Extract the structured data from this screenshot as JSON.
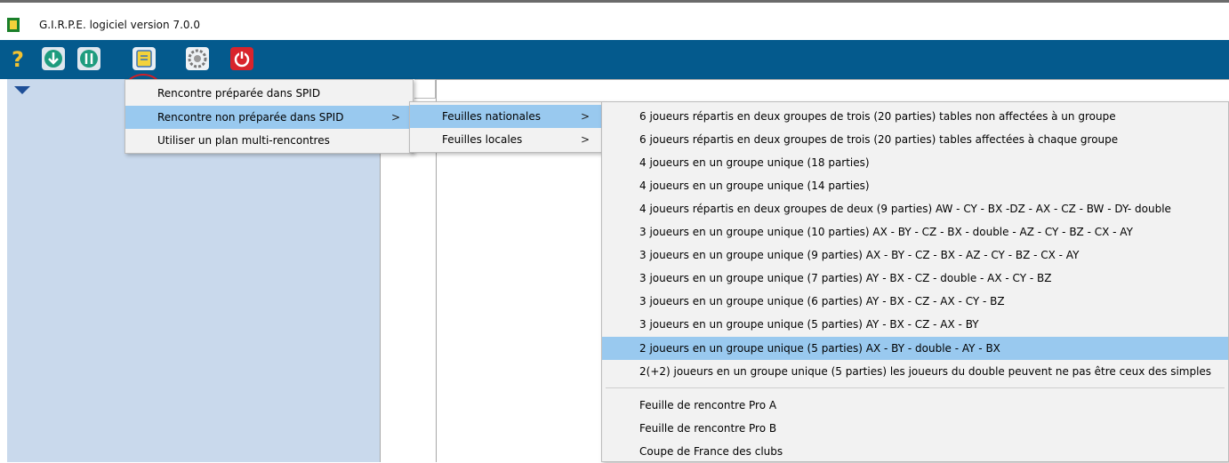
{
  "app": {
    "title": "G.I.R.P.E.  logiciel version  7.0.0"
  },
  "toolbar": {
    "buttons": [
      {
        "icon": "help-icon"
      },
      {
        "icon": "download-icon"
      },
      {
        "icon": "sync-icon"
      },
      {
        "icon": "new-document-icon"
      },
      {
        "icon": "settings-icon"
      },
      {
        "icon": "power-icon"
      }
    ]
  },
  "menu1": {
    "items": [
      {
        "label": "Rencontre préparée dans SPID"
      },
      {
        "label": "Rencontre non préparée dans SPID",
        "arrow": ">"
      },
      {
        "label": "Utiliser un plan multi-rencontres"
      }
    ]
  },
  "menu2": {
    "items": [
      {
        "label": "Feuilles nationales",
        "arrow": ">"
      },
      {
        "label": "Feuilles locales",
        "arrow": ">"
      }
    ]
  },
  "menu3": {
    "items": [
      {
        "label": "6 joueurs répartis en deux groupes de trois (20 parties) tables non affectées à un groupe"
      },
      {
        "label": "6 joueurs répartis en deux groupes de trois (20 parties) tables affectées à  chaque groupe"
      },
      {
        "label": "4 joueurs en un groupe unique (18 parties)"
      },
      {
        "label": "4 joueurs en un groupe unique (14 parties)"
      },
      {
        "label": "4 joueurs répartis en deux groupes de deux (9 parties) AW - CY - BX -DZ - AX - CZ - BW - DY- double"
      },
      {
        "label": "3 joueurs en un groupe unique (10 parties) AX - BY - CZ - BX - double - AZ - CY - BZ - CX - AY"
      },
      {
        "label": "3 joueurs en un groupe unique (9 parties) AX - BY - CZ - BX - AZ - CY - BZ - CX - AY"
      },
      {
        "label": "3 joueurs  en un groupe unique (7 parties)  AY - BX - CZ - double - AX - CY - BZ"
      },
      {
        "label": "3 joueurs  en un groupe unique (6 parties) AY - BX - CZ - AX - CY - BZ"
      },
      {
        "label": "3 joueurs  en un groupe unique (5 parties) AY - BX - CZ - AX - BY"
      },
      {
        "label": "2 joueurs  en un groupe unique (5 parties) AX - BY - double - AY - BX"
      },
      {
        "label": "2(+2) joueurs en un groupe unique (5 parties) les joueurs du double peuvent ne pas être ceux des simples"
      },
      {
        "label": "Feuille de rencontre Pro A"
      },
      {
        "label": "Feuille de rencontre Pro B"
      },
      {
        "label": "Coupe de France des clubs"
      }
    ]
  },
  "colors": {
    "toolbar": "#045a8d",
    "left_panel": "#c9d9ec",
    "menu_bg": "#f2f2f2",
    "selection": "#99c9ef",
    "highlight_ring": "#d21f26"
  }
}
